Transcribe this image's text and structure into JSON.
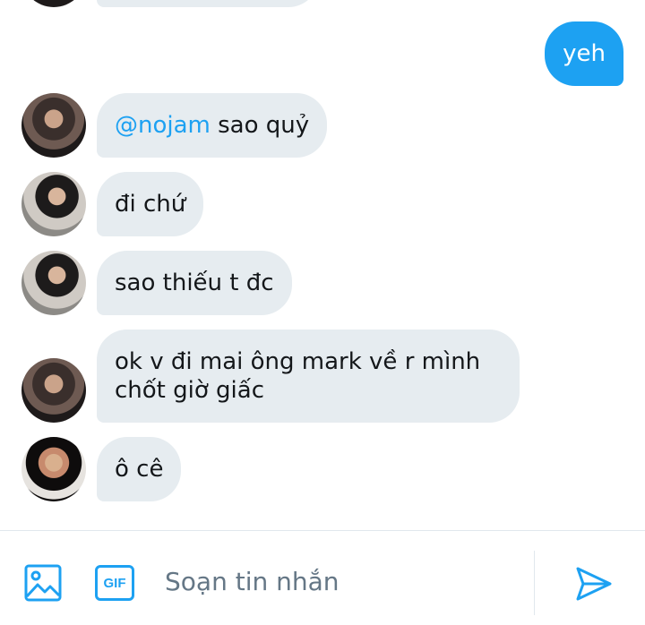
{
  "messages": [
    {
      "direction": "out",
      "text": "yeh"
    },
    {
      "direction": "in",
      "mention": "@nojam",
      "text": " sao quỷ"
    },
    {
      "direction": "in",
      "text": "đi chứ"
    },
    {
      "direction": "in",
      "text": "sao thiếu t đc"
    },
    {
      "direction": "in",
      "text": "ok v đi mai ông mark về r mình\nchốt giờ giấc"
    },
    {
      "direction": "in",
      "text": "ô cê"
    }
  ],
  "composer": {
    "placeholder": "Soạn tin nhắn",
    "gif_label": "GIF",
    "image_icon": "image-icon",
    "send_icon": "send-icon"
  },
  "colors": {
    "accent": "#1da1f2",
    "incoming_bubble": "#e6ecf0",
    "placeholder": "#657786"
  }
}
